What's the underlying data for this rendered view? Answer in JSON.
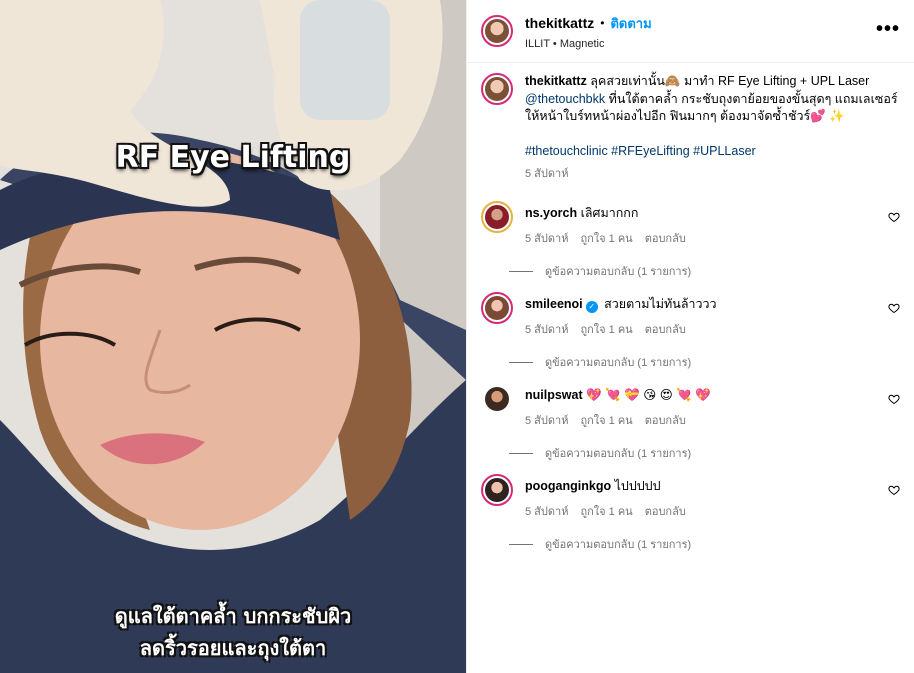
{
  "photo": {
    "overlay_title": "RF Eye Lifting",
    "overlay_line1": "ดูแลใต้ตาคล้ำ บกกระชับผิว",
    "overlay_line2": "ลดริ้วรอยและถุงใต้ตา"
  },
  "header": {
    "username": "thekitkattz",
    "separator": "•",
    "follow_label": "ติดตาม",
    "audio": "ILLIT • Magnetic",
    "more": "•••"
  },
  "caption": {
    "username": "thekitkattz",
    "text_start": " ลุคสวยเท่านั้น🙈 มาทำ RF Eye Lifting + UPL Laser ",
    "mention": "@thetouchbkk",
    "text_end": " ที่นใต้ตาคล้ำ กระชับถุงตาย้อยของขั้นสุดๆ แถมเลเซอร์ให้หน้าใบร์ทหน้าผ่องไปอีก ฟินมากๆ ต้องมาจัดซ้ำชัวร์💕 ✨",
    "hashtags": "#thetouchclinic #RFEyeLifting #UPLLaser",
    "time": "5 สัปดาห์"
  },
  "comments": [
    {
      "username": "ns.yorch",
      "text": "เลิศมากกก",
      "verified": false,
      "time": "5 สัปดาห์",
      "likes": "ถูกใจ 1 คน",
      "reply": "ตอบกลับ",
      "view_replies": "ดูข้อความตอบกลับ (1 รายการ)"
    },
    {
      "username": "smileenoi",
      "text": "สวยตามไม่ทันล้าววว",
      "verified": true,
      "time": "5 สัปดาห์",
      "likes": "ถูกใจ 1 คน",
      "reply": "ตอบกลับ",
      "view_replies": "ดูข้อความตอบกลับ (1 รายการ)"
    },
    {
      "username": "nuilpswat",
      "text": "💖 💘 💝 😘 😍 💘 💖",
      "verified": false,
      "time": "5 สัปดาห์",
      "likes": "ถูกใจ 1 คน",
      "reply": "ตอบกลับ",
      "view_replies": "ดูข้อความตอบกลับ (1 รายการ)"
    },
    {
      "username": "pooganginkgo",
      "text": "ไปปปปป",
      "verified": false,
      "time": "5 สัปดาห์",
      "likes": "ถูกใจ 1 คน",
      "reply": "ตอบกลับ",
      "view_replies": "ดูข้อความตอบกลับ (1 รายการ)"
    }
  ],
  "icons": {
    "heart": "heart-outline-icon",
    "verified": "verified-badge-icon",
    "more": "more-options-icon"
  },
  "colors": {
    "follow": "#0095f6",
    "link": "#00376b",
    "muted": "#737373",
    "verified": "#0095f6"
  }
}
